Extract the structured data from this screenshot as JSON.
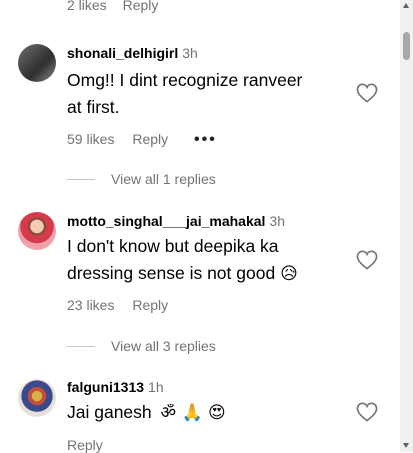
{
  "top_meta": {
    "likes": "2 likes",
    "reply": "Reply"
  },
  "comments": [
    {
      "username": "shonali_delhigirl",
      "time": "3h",
      "text_line1": "Omg!! I dint recognize ranveer",
      "text_line2": "at first.",
      "likes": "59 likes",
      "reply": "Reply",
      "more": "•••",
      "view_replies": "View all 1 replies"
    },
    {
      "username": "motto_singhal___jai_mahakal",
      "time": "3h",
      "text_line1": "I don't know but deepika ka",
      "text_line2": "dressing sense is not good",
      "emoji": "😥",
      "likes": "23 likes",
      "reply": "Reply",
      "view_replies": "View all 3 replies"
    },
    {
      "username": "falguni1313",
      "time": "1h",
      "text": "Jai ganesh",
      "emojis": "ॐ 🙏 😍",
      "reply": "Reply"
    }
  ],
  "icons": [
    "heart-icon",
    "more-options-icon",
    "avatar"
  ],
  "colors": {
    "secondary_text": "#737373",
    "divider": "#c7c7c7",
    "scroll_thumb": "#a8a8a8"
  }
}
